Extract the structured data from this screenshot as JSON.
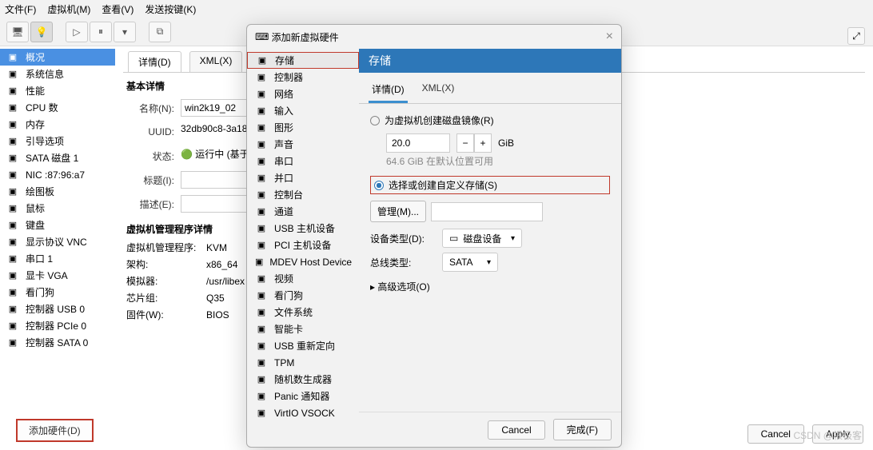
{
  "menubar": [
    "文件(F)",
    "虚拟机(M)",
    "查看(V)",
    "发送按键(K)"
  ],
  "sidebar": {
    "items": [
      {
        "label": "概况",
        "icon": "monitor-icon",
        "selected": true
      },
      {
        "label": "系统信息",
        "icon": "info-icon"
      },
      {
        "label": "性能",
        "icon": "gauge-icon"
      },
      {
        "label": "CPU 数",
        "icon": "cpu-icon"
      },
      {
        "label": "内存",
        "icon": "ram-icon"
      },
      {
        "label": "引导选项",
        "icon": "boot-icon"
      },
      {
        "label": "SATA 磁盘 1",
        "icon": "disk-icon"
      },
      {
        "label": "NIC :87:96:a7",
        "icon": "nic-icon"
      },
      {
        "label": "绘图板",
        "icon": "tablet-icon"
      },
      {
        "label": "鼠标",
        "icon": "mouse-icon"
      },
      {
        "label": "键盘",
        "icon": "keyboard-icon"
      },
      {
        "label": "显示协议 VNC",
        "icon": "display-icon"
      },
      {
        "label": "串口 1",
        "icon": "serial-icon"
      },
      {
        "label": "显卡 VGA",
        "icon": "gpu-icon"
      },
      {
        "label": "看门狗",
        "icon": "watchdog-icon"
      },
      {
        "label": "控制器 USB 0",
        "icon": "usb-ctrl-icon"
      },
      {
        "label": "控制器 PCIe 0",
        "icon": "pcie-ctrl-icon"
      },
      {
        "label": "控制器 SATA 0",
        "icon": "sata-ctrl-icon"
      }
    ]
  },
  "tabs": [
    {
      "label": "详情(D)",
      "active": true
    },
    {
      "label": "XML(X)"
    }
  ],
  "details": {
    "basic_title": "基本详情",
    "name": {
      "label": "名称(N):",
      "value": "win2k19_02"
    },
    "uuid": {
      "label": "UUID:",
      "value": "32db90c8-3a18"
    },
    "state": {
      "label": "状态:",
      "value": "🟢 运行中 (基于…)"
    },
    "title": {
      "label": "标题(I):",
      "value": ""
    },
    "desc": {
      "label": "描述(E):",
      "value": ""
    },
    "hyp_title": "虚拟机管理程序详情",
    "rows": [
      {
        "lbl": "虚拟机管理程序:",
        "val": "KVM"
      },
      {
        "lbl": "架构:",
        "val": "x86_64"
      },
      {
        "lbl": "模拟器:",
        "val": "/usr/libex"
      },
      {
        "lbl": "芯片组:",
        "val": "Q35"
      },
      {
        "lbl": "固件(W):",
        "val": "BIOS"
      }
    ]
  },
  "add_hw_btn": "添加硬件(D)",
  "dialog": {
    "title": "添加新虚拟硬件",
    "side": [
      {
        "label": "存储",
        "icon": "storage-icon",
        "selected": true,
        "boxed": true
      },
      {
        "label": "控制器",
        "icon": "controller-icon"
      },
      {
        "label": "网络",
        "icon": "network-icon"
      },
      {
        "label": "输入",
        "icon": "input-icon"
      },
      {
        "label": "图形",
        "icon": "graphics-icon"
      },
      {
        "label": "声音",
        "icon": "sound-icon"
      },
      {
        "label": "串口",
        "icon": "serial-icon"
      },
      {
        "label": "并口",
        "icon": "parallel-icon"
      },
      {
        "label": "控制台",
        "icon": "console-icon"
      },
      {
        "label": "通道",
        "icon": "channel-icon"
      },
      {
        "label": "USB 主机设备",
        "icon": "usb-host-icon"
      },
      {
        "label": "PCI 主机设备",
        "icon": "pci-host-icon"
      },
      {
        "label": "MDEV Host Device",
        "icon": "mdev-icon"
      },
      {
        "label": "视频",
        "icon": "video-icon"
      },
      {
        "label": "看门狗",
        "icon": "watchdog-icon"
      },
      {
        "label": "文件系统",
        "icon": "fs-icon"
      },
      {
        "label": "智能卡",
        "icon": "smartcard-icon"
      },
      {
        "label": "USB 重新定向",
        "icon": "usb-redir-icon"
      },
      {
        "label": "TPM",
        "icon": "tpm-icon"
      },
      {
        "label": "随机数生成器",
        "icon": "rng-icon"
      },
      {
        "label": "Panic 通知器",
        "icon": "panic-icon"
      },
      {
        "label": "VirtIO VSOCK",
        "icon": "vsock-icon"
      }
    ],
    "header": "存储",
    "tabs": [
      {
        "label": "详情(D)",
        "active": true
      },
      {
        "label": "XML(X)"
      }
    ],
    "radio1": "为虚拟机创建磁盘镜像(R)",
    "size_value": "20.0",
    "size_unit": "GiB",
    "size_hint": "64.6 GiB 在默认位置可用",
    "radio2": "选择或创建自定义存储(S)",
    "manage_btn": "管理(M)...",
    "device_type_label": "设备类型(D):",
    "device_type_value": "磁盘设备",
    "bus_type_label": "总线类型:",
    "bus_type_value": "SATA",
    "advanced": "高级选项(O)",
    "cancel": "Cancel",
    "finish": "完成(F)"
  },
  "app_footer": {
    "cancel": "Cancel",
    "apply": "Apply"
  },
  "watermark": "CSDN @根极客"
}
